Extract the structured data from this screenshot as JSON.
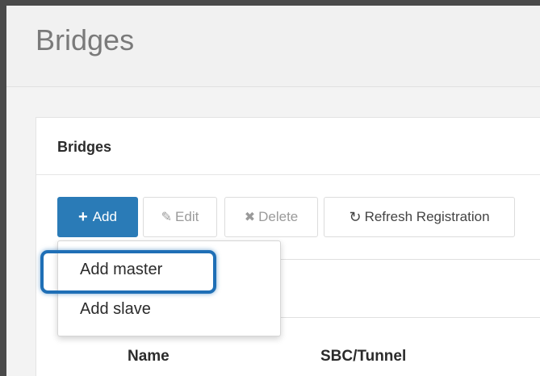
{
  "page": {
    "title": "Bridges"
  },
  "card": {
    "title": "Bridges"
  },
  "toolbar": {
    "add_label": "Add",
    "edit_label": "Edit",
    "delete_label": "Delete",
    "refresh_label": "Refresh Registration",
    "icons": {
      "add": "plus-icon",
      "edit": "pencil-icon",
      "delete": "x-icon",
      "refresh": "refresh-icon"
    }
  },
  "dropdown": {
    "items": [
      {
        "label": "Add master"
      },
      {
        "label": "Add slave"
      }
    ]
  },
  "table": {
    "columns": [
      "Name",
      "SBC/Tunnel"
    ]
  },
  "colors": {
    "primary": "#2a7bb7",
    "highlight": "#1f6fb6",
    "background": "#f3f3f3"
  }
}
